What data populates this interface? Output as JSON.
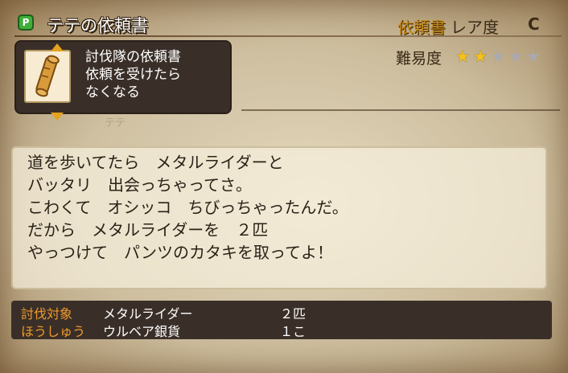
{
  "header": {
    "title": "テテの依頼書",
    "rarity_label": "依頼書",
    "rarity_word": "レア度",
    "rarity_value": "C"
  },
  "item": {
    "icon": "scroll-icon",
    "description_lines": [
      "討伐隊の依頼書",
      "依頼を受けたら",
      "なくなる"
    ]
  },
  "difficulty": {
    "label": "難易度",
    "stars_total": 5,
    "stars_filled": 2
  },
  "background_text": "テテ",
  "message": {
    "lines": [
      "道を歩いてたら　メタルライダーと",
      "バッタリ　出会っちゃってさ。",
      "こわくて　オシッコ　ちびっちゃったんだ。",
      "だから　メタルライダーを　２匹",
      "やっつけて　パンツのカタキを取ってよ！"
    ]
  },
  "info": {
    "rows": [
      {
        "label": "討伐対象",
        "value": "メタルライダー",
        "count": "２匹"
      },
      {
        "label": "ほうしゅう",
        "value": "ウルベア銀貨",
        "count": "１こ"
      }
    ]
  },
  "colors": {
    "panel": "#3a2f28",
    "accent_orange": "#f09a2c",
    "rarity_gold": "#c98a12",
    "star_on": "#f3c21d",
    "star_off": "#a9a9b1",
    "icon_green": "#3fae3a"
  }
}
